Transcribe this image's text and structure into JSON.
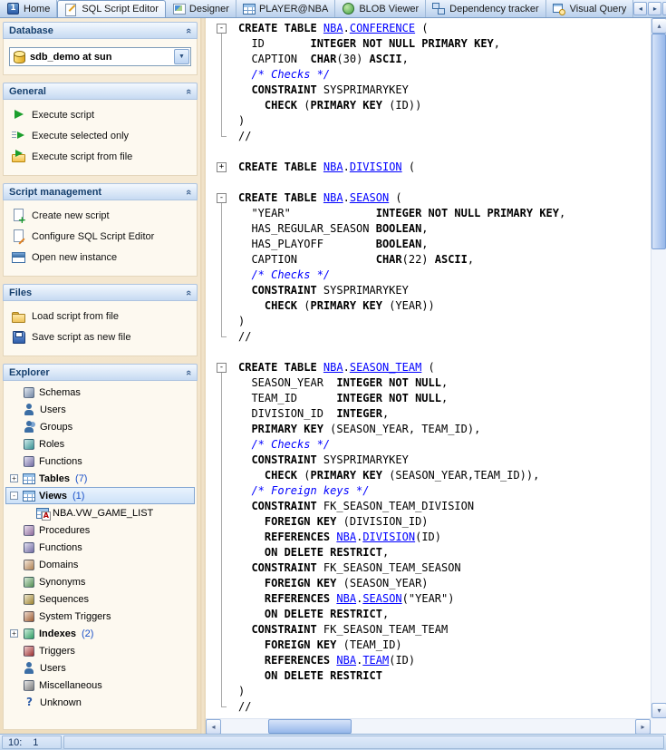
{
  "tabbar": {
    "tabs": [
      {
        "label": "Home",
        "icon": "home-window-icon",
        "shape": "win1",
        "active": false
      },
      {
        "label": "SQL Script Editor",
        "icon": "sql-script-editor-icon",
        "shape": "script",
        "active": true
      },
      {
        "label": "Designer",
        "icon": "designer-icon",
        "shape": "designer",
        "active": false
      },
      {
        "label": "PLAYER@NBA",
        "icon": "player-table-icon",
        "shape": "grid",
        "active": false
      },
      {
        "label": "BLOB Viewer",
        "icon": "blob-viewer-icon",
        "shape": "blob",
        "active": false
      },
      {
        "label": "Dependency tracker",
        "icon": "dependency-tracker-icon",
        "shape": "dependency",
        "active": false
      },
      {
        "label": "Visual Query",
        "icon": "visual-query-icon",
        "shape": "vquery",
        "active": false
      }
    ],
    "scroll_left": "◂",
    "scroll_right": "▸",
    "close": "×"
  },
  "sidebar": {
    "database": {
      "title": "Database",
      "value": "sdb_demo at sun",
      "dropdown": "▼"
    },
    "sections": [
      {
        "title": "General",
        "items": [
          {
            "label": "Execute script",
            "icon": "execute-script-icon",
            "shape": "play"
          },
          {
            "label": "Execute selected only",
            "icon": "execute-selected-only-icon",
            "shape": "play-lines"
          },
          {
            "label": "Execute script from file",
            "icon": "execute-script-from-file-icon",
            "shape": "play-file"
          }
        ]
      },
      {
        "title": "Script management",
        "items": [
          {
            "label": "Create new script",
            "icon": "create-new-script-icon",
            "shape": "page-plus"
          },
          {
            "label": "Configure SQL Script Editor",
            "icon": "configure-sql-script-editor-icon",
            "shape": "page-gear"
          },
          {
            "label": "Open new instance",
            "icon": "open-new-instance-icon",
            "shape": "window"
          }
        ]
      },
      {
        "title": "Files",
        "items": [
          {
            "label": "Load script from file",
            "icon": "load-script-from-file-icon",
            "shape": "folder"
          },
          {
            "label": "Save script as new file",
            "icon": "save-script-as-new-file-icon",
            "shape": "save"
          }
        ]
      }
    ],
    "explorer": {
      "title": "Explorer",
      "items": [
        {
          "label": "Schemas",
          "icon": "schemas-icon",
          "shape": "cube",
          "color": "#8fa8cc"
        },
        {
          "label": "Users",
          "icon": "users-icon",
          "shape": "person",
          "color": "#3b6ea5"
        },
        {
          "label": "Groups",
          "icon": "groups-icon",
          "shape": "person2",
          "color": "#3b6ea5"
        },
        {
          "label": "Roles",
          "icon": "roles-icon",
          "shape": "cube",
          "color": "#45b5b5"
        },
        {
          "label": "Functions",
          "icon": "functions-icon",
          "shape": "cube",
          "color": "#8f86c9"
        },
        {
          "label": "Tables",
          "count": "(7)",
          "bold": true,
          "expander": "+",
          "icon": "tables-icon",
          "shape": "grid"
        },
        {
          "label": "Views",
          "count": "(1)",
          "bold": true,
          "expander": "-",
          "selected": true,
          "icon": "views-icon",
          "shape": "grid"
        },
        {
          "label": "NBA.VW_GAME_LIST",
          "child": true,
          "icon": "view-item-icon",
          "shape": "grid-a"
        },
        {
          "label": "Procedures",
          "icon": "procedures-icon",
          "shape": "cube",
          "color": "#b085c0"
        },
        {
          "label": "Functions",
          "icon": "functions-2-icon",
          "shape": "cube",
          "color": "#8f86c9"
        },
        {
          "label": "Domains",
          "icon": "domains-icon",
          "shape": "cube",
          "color": "#d9a066"
        },
        {
          "label": "Synonyms",
          "icon": "synonyms-icon",
          "shape": "cube",
          "color": "#66b066"
        },
        {
          "label": "Sequences",
          "icon": "sequences-icon",
          "shape": "cube",
          "color": "#c2a23b"
        },
        {
          "label": "System Triggers",
          "icon": "system-triggers-icon",
          "shape": "cube",
          "color": "#c2703b"
        },
        {
          "label": "Indexes",
          "count": "(2)",
          "bold": true,
          "expander": "+",
          "icon": "indexes-icon",
          "shape": "cube",
          "color": "#3bc27a"
        },
        {
          "label": "Triggers",
          "icon": "triggers-icon",
          "shape": "cube",
          "color": "#c23b3b"
        },
        {
          "label": "Users",
          "icon": "users-2-icon",
          "shape": "person",
          "color": "#3b6ea5"
        },
        {
          "label": "Miscellaneous",
          "icon": "miscellaneous-icon",
          "shape": "cube",
          "color": "#9a9a9a"
        },
        {
          "label": "Unknown",
          "icon": "unknown-icon",
          "shape": "question"
        }
      ]
    }
  },
  "editor": {
    "colors": {
      "keyword": "#000000",
      "object": "#0000ff",
      "comment": "#0000ff"
    },
    "lines": [
      {
        "fold": "open",
        "tokens": [
          [
            "CREATE TABLE ",
            "kw"
          ],
          [
            "NBA",
            "obj"
          ],
          [
            ".",
            "pl"
          ],
          [
            "CONFERENCE",
            "obj"
          ],
          [
            " (",
            "pl"
          ]
        ]
      },
      {
        "fold": "mid",
        "tokens": [
          [
            "  ID       ",
            "pl"
          ],
          [
            "INTEGER NOT NULL PRIMARY KEY",
            "kw"
          ],
          [
            ",",
            "pl"
          ]
        ]
      },
      {
        "fold": "mid",
        "tokens": [
          [
            "  CAPTION  ",
            "pl"
          ],
          [
            "CHAR",
            "kw"
          ],
          [
            "(30) ",
            "pl"
          ],
          [
            "ASCII",
            "kw"
          ],
          [
            ",",
            "pl"
          ]
        ]
      },
      {
        "fold": "mid",
        "tokens": [
          [
            "  ",
            "pl"
          ],
          [
            "/* Checks */",
            "cmt"
          ]
        ]
      },
      {
        "fold": "mid",
        "tokens": [
          [
            "  ",
            "pl"
          ],
          [
            "CONSTRAINT",
            "kw"
          ],
          [
            " SYSPRIMARYKEY",
            "pl"
          ]
        ]
      },
      {
        "fold": "mid",
        "tokens": [
          [
            "    ",
            "pl"
          ],
          [
            "CHECK",
            "kw"
          ],
          [
            " (",
            "pl"
          ],
          [
            "PRIMARY KEY",
            "kw"
          ],
          [
            " (ID))",
            "pl"
          ]
        ]
      },
      {
        "fold": "mid",
        "tokens": [
          [
            ")",
            "pl"
          ]
        ]
      },
      {
        "fold": "end",
        "tokens": [
          [
            "//",
            "pl"
          ]
        ]
      },
      {
        "fold": "none",
        "tokens": []
      },
      {
        "fold": "closed",
        "tokens": [
          [
            "CREATE TABLE ",
            "kw"
          ],
          [
            "NBA",
            "obj"
          ],
          [
            ".",
            "pl"
          ],
          [
            "DIVISION",
            "obj"
          ],
          [
            " (",
            "pl"
          ]
        ]
      },
      {
        "fold": "none",
        "tokens": []
      },
      {
        "fold": "open",
        "tokens": [
          [
            "CREATE TABLE ",
            "kw"
          ],
          [
            "NBA",
            "obj"
          ],
          [
            ".",
            "pl"
          ],
          [
            "SEASON",
            "obj"
          ],
          [
            " (",
            "pl"
          ]
        ]
      },
      {
        "fold": "mid",
        "tokens": [
          [
            "  \"YEAR\"             ",
            "pl"
          ],
          [
            "INTEGER NOT NULL PRIMARY KEY",
            "kw"
          ],
          [
            ",",
            "pl"
          ]
        ]
      },
      {
        "fold": "mid",
        "tokens": [
          [
            "  HAS_REGULAR_SEASON ",
            "pl"
          ],
          [
            "BOOLEAN",
            "kw"
          ],
          [
            ",",
            "pl"
          ]
        ]
      },
      {
        "fold": "mid",
        "tokens": [
          [
            "  HAS_PLAYOFF        ",
            "pl"
          ],
          [
            "BOOLEAN",
            "kw"
          ],
          [
            ",",
            "pl"
          ]
        ]
      },
      {
        "fold": "mid",
        "tokens": [
          [
            "  CAPTION            ",
            "pl"
          ],
          [
            "CHAR",
            "kw"
          ],
          [
            "(22) ",
            "pl"
          ],
          [
            "ASCII",
            "kw"
          ],
          [
            ",",
            "pl"
          ]
        ]
      },
      {
        "fold": "mid",
        "tokens": [
          [
            "  ",
            "pl"
          ],
          [
            "/* Checks */",
            "cmt"
          ]
        ]
      },
      {
        "fold": "mid",
        "tokens": [
          [
            "  ",
            "pl"
          ],
          [
            "CONSTRAINT",
            "kw"
          ],
          [
            " SYSPRIMARYKEY",
            "pl"
          ]
        ]
      },
      {
        "fold": "mid",
        "tokens": [
          [
            "    ",
            "pl"
          ],
          [
            "CHECK",
            "kw"
          ],
          [
            " (",
            "pl"
          ],
          [
            "PRIMARY KEY",
            "kw"
          ],
          [
            " (YEAR))",
            "pl"
          ]
        ]
      },
      {
        "fold": "mid",
        "tokens": [
          [
            ")",
            "pl"
          ]
        ]
      },
      {
        "fold": "end",
        "tokens": [
          [
            "//",
            "pl"
          ]
        ]
      },
      {
        "fold": "none",
        "tokens": []
      },
      {
        "fold": "open",
        "tokens": [
          [
            "CREATE TABLE ",
            "kw"
          ],
          [
            "NBA",
            "obj"
          ],
          [
            ".",
            "pl"
          ],
          [
            "SEASON_TEAM",
            "obj"
          ],
          [
            " (",
            "pl"
          ]
        ]
      },
      {
        "fold": "mid",
        "tokens": [
          [
            "  SEASON_YEAR  ",
            "pl"
          ],
          [
            "INTEGER NOT NULL",
            "kw"
          ],
          [
            ",",
            "pl"
          ]
        ]
      },
      {
        "fold": "mid",
        "tokens": [
          [
            "  TEAM_ID      ",
            "pl"
          ],
          [
            "INTEGER NOT NULL",
            "kw"
          ],
          [
            ",",
            "pl"
          ]
        ]
      },
      {
        "fold": "mid",
        "tokens": [
          [
            "  DIVISION_ID  ",
            "pl"
          ],
          [
            "INTEGER",
            "kw"
          ],
          [
            ",",
            "pl"
          ]
        ]
      },
      {
        "fold": "mid",
        "tokens": [
          [
            "  ",
            "pl"
          ],
          [
            "PRIMARY KEY",
            "kw"
          ],
          [
            " (SEASON_YEAR, TEAM_ID),",
            "pl"
          ]
        ]
      },
      {
        "fold": "mid",
        "tokens": [
          [
            "  ",
            "pl"
          ],
          [
            "/* Checks */",
            "cmt"
          ]
        ]
      },
      {
        "fold": "mid",
        "tokens": [
          [
            "  ",
            "pl"
          ],
          [
            "CONSTRAINT",
            "kw"
          ],
          [
            " SYSPRIMARYKEY",
            "pl"
          ]
        ]
      },
      {
        "fold": "mid",
        "tokens": [
          [
            "    ",
            "pl"
          ],
          [
            "CHECK",
            "kw"
          ],
          [
            " (",
            "pl"
          ],
          [
            "PRIMARY KEY",
            "kw"
          ],
          [
            " (SEASON_YEAR,TEAM_ID)),",
            "pl"
          ]
        ]
      },
      {
        "fold": "mid",
        "tokens": [
          [
            "  ",
            "pl"
          ],
          [
            "/* Foreign keys */",
            "cmt"
          ]
        ]
      },
      {
        "fold": "mid",
        "tokens": [
          [
            "  ",
            "pl"
          ],
          [
            "CONSTRAINT",
            "kw"
          ],
          [
            " FK_SEASON_TEAM_DIVISION",
            "pl"
          ]
        ]
      },
      {
        "fold": "mid",
        "tokens": [
          [
            "    ",
            "pl"
          ],
          [
            "FOREIGN KEY",
            "kw"
          ],
          [
            " (DIVISION_ID)",
            "pl"
          ]
        ]
      },
      {
        "fold": "mid",
        "tokens": [
          [
            "    ",
            "pl"
          ],
          [
            "REFERENCES",
            "kw"
          ],
          [
            " ",
            "pl"
          ],
          [
            "NBA",
            "obj"
          ],
          [
            ".",
            "pl"
          ],
          [
            "DIVISION",
            "obj"
          ],
          [
            "(ID)",
            "pl"
          ]
        ]
      },
      {
        "fold": "mid",
        "tokens": [
          [
            "    ",
            "pl"
          ],
          [
            "ON DELETE RESTRICT",
            "kw"
          ],
          [
            ",",
            "pl"
          ]
        ]
      },
      {
        "fold": "mid",
        "tokens": [
          [
            "  ",
            "pl"
          ],
          [
            "CONSTRAINT",
            "kw"
          ],
          [
            " FK_SEASON_TEAM_SEASON",
            "pl"
          ]
        ]
      },
      {
        "fold": "mid",
        "tokens": [
          [
            "    ",
            "pl"
          ],
          [
            "FOREIGN KEY",
            "kw"
          ],
          [
            " (SEASON_YEAR)",
            "pl"
          ]
        ]
      },
      {
        "fold": "mid",
        "tokens": [
          [
            "    ",
            "pl"
          ],
          [
            "REFERENCES",
            "kw"
          ],
          [
            " ",
            "pl"
          ],
          [
            "NBA",
            "obj"
          ],
          [
            ".",
            "pl"
          ],
          [
            "SEASON",
            "obj"
          ],
          [
            "(\"YEAR\")",
            "pl"
          ]
        ]
      },
      {
        "fold": "mid",
        "tokens": [
          [
            "    ",
            "pl"
          ],
          [
            "ON DELETE RESTRICT",
            "kw"
          ],
          [
            ",",
            "pl"
          ]
        ]
      },
      {
        "fold": "mid",
        "tokens": [
          [
            "  ",
            "pl"
          ],
          [
            "CONSTRAINT",
            "kw"
          ],
          [
            " FK_SEASON_TEAM_TEAM",
            "pl"
          ]
        ]
      },
      {
        "fold": "mid",
        "tokens": [
          [
            "    ",
            "pl"
          ],
          [
            "FOREIGN KEY",
            "kw"
          ],
          [
            " (TEAM_ID)",
            "pl"
          ]
        ]
      },
      {
        "fold": "mid",
        "tokens": [
          [
            "    ",
            "pl"
          ],
          [
            "REFERENCES",
            "kw"
          ],
          [
            " ",
            "pl"
          ],
          [
            "NBA",
            "obj"
          ],
          [
            ".",
            "pl"
          ],
          [
            "TEAM",
            "obj"
          ],
          [
            "(ID)",
            "pl"
          ]
        ]
      },
      {
        "fold": "mid",
        "tokens": [
          [
            "    ",
            "pl"
          ],
          [
            "ON DELETE RESTRICT",
            "kw"
          ]
        ]
      },
      {
        "fold": "mid",
        "tokens": [
          [
            ")",
            "pl"
          ]
        ]
      },
      {
        "fold": "end",
        "tokens": [
          [
            "//",
            "pl"
          ]
        ]
      }
    ]
  },
  "scrollbar": {
    "up": "▴",
    "down": "▾",
    "left": "◂",
    "right": "▸"
  },
  "statusbar": {
    "line": "10:",
    "col": "1"
  }
}
